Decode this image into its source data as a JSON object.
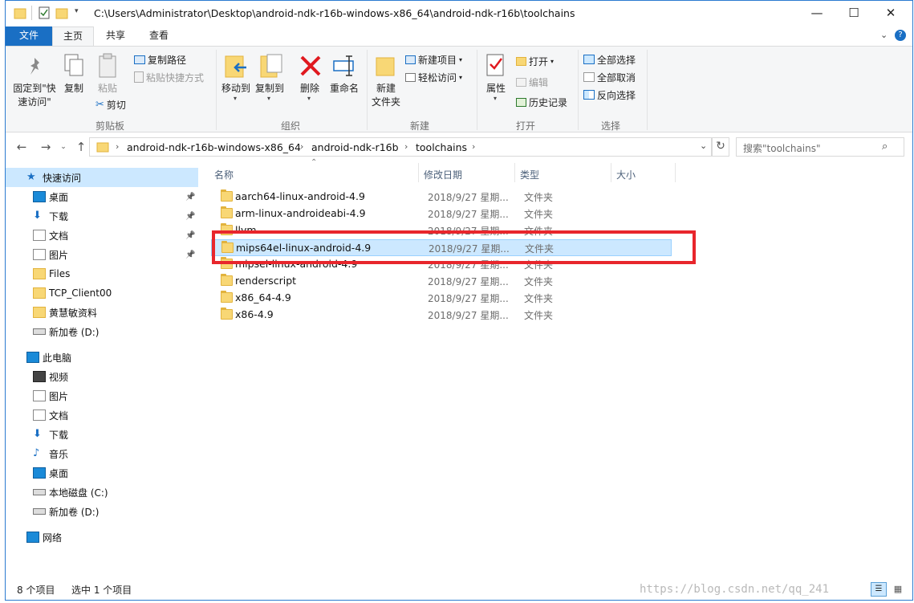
{
  "window": {
    "title": "C:\\Users\\Administrator\\Desktop\\android-ndk-r16b-windows-x86_64\\android-ndk-r16b\\toolchains",
    "minimize": "—",
    "maximize": "☐",
    "close": "✕"
  },
  "tabs": {
    "file": "文件",
    "home": "主页",
    "share": "共享",
    "view": "查看"
  },
  "ribbon": {
    "clipboard": {
      "pin_line1": "固定到\"快",
      "pin_line2": "速访问\"",
      "copy": "复制",
      "paste": "粘贴",
      "copy_path": "复制路径",
      "paste_shortcut": "粘贴快捷方式",
      "cut": "剪切",
      "group": "剪贴板"
    },
    "organize": {
      "move_to": "移动到",
      "copy_to": "复制到",
      "delete": "删除",
      "rename": "重命名",
      "group": "组织"
    },
    "new": {
      "new_folder_line1": "新建",
      "new_folder_line2": "文件夹",
      "new_item": "新建项目",
      "easy_access": "轻松访问",
      "group": "新建"
    },
    "open": {
      "properties": "属性",
      "open": "打开",
      "edit": "编辑",
      "history": "历史记录",
      "group": "打开"
    },
    "select": {
      "select_all": "全部选择",
      "select_none": "全部取消",
      "invert": "反向选择",
      "group": "选择"
    }
  },
  "address": {
    "crumbs": [
      "android-ndk-r16b-windows-x86_64",
      "android-ndk-r16b",
      "toolchains"
    ],
    "search_placeholder": "搜索\"toolchains\""
  },
  "nav": [
    {
      "label": "快速访问",
      "icon": "star-icon",
      "pinned": false
    },
    {
      "label": "桌面",
      "icon": "desktop-icon",
      "pinned": true
    },
    {
      "label": "下载",
      "icon": "download-icon",
      "pinned": true
    },
    {
      "label": "文档",
      "icon": "document-icon",
      "pinned": true
    },
    {
      "label": "图片",
      "icon": "picture-icon",
      "pinned": true
    },
    {
      "label": "Files",
      "icon": "folder-icon",
      "pinned": false
    },
    {
      "label": "TCP_Client00",
      "icon": "folder-icon",
      "pinned": false
    },
    {
      "label": "黄慧敏资料",
      "icon": "folder-icon",
      "pinned": false
    },
    {
      "label": "新加卷 (D:)",
      "icon": "drive-icon",
      "pinned": false
    },
    {
      "label": "此电脑",
      "icon": "computer-icon",
      "pinned": false
    },
    {
      "label": "视频",
      "icon": "video-icon",
      "pinned": false
    },
    {
      "label": "图片",
      "icon": "picture-icon",
      "pinned": false
    },
    {
      "label": "文档",
      "icon": "document-icon",
      "pinned": false
    },
    {
      "label": "下载",
      "icon": "download-icon",
      "pinned": false
    },
    {
      "label": "音乐",
      "icon": "music-icon",
      "pinned": false
    },
    {
      "label": "桌面",
      "icon": "desktop-icon",
      "pinned": false
    },
    {
      "label": "本地磁盘 (C:)",
      "icon": "drive-icon",
      "pinned": false
    },
    {
      "label": "新加卷 (D:)",
      "icon": "drive-icon",
      "pinned": false
    },
    {
      "label": "网络",
      "icon": "network-icon",
      "pinned": false
    }
  ],
  "columns": {
    "name": "名称",
    "date": "修改日期",
    "type": "类型",
    "size": "大小"
  },
  "files": [
    {
      "name": "aarch64-linux-android-4.9",
      "date": "2018/9/27 星期...",
      "type": "文件夹"
    },
    {
      "name": "arm-linux-androideabi-4.9",
      "date": "2018/9/27 星期...",
      "type": "文件夹"
    },
    {
      "name": "llvm",
      "date": "2018/9/27 星期...",
      "type": "文件夹"
    },
    {
      "name": "mips64el-linux-android-4.9",
      "date": "2018/9/27 星期...",
      "type": "文件夹",
      "selected": true
    },
    {
      "name": "mipsel-linux-android-4.9",
      "date": "2018/9/27 星期...",
      "type": "文件夹"
    },
    {
      "name": "renderscript",
      "date": "2018/9/27 星期...",
      "type": "文件夹"
    },
    {
      "name": "x86_64-4.9",
      "date": "2018/9/27 星期...",
      "type": "文件夹"
    },
    {
      "name": "x86-4.9",
      "date": "2018/9/27 星期...",
      "type": "文件夹"
    }
  ],
  "status": {
    "count": "8 个项目",
    "selected": "选中 1 个项目"
  },
  "watermark": "https://blog.csdn.net/qq_241",
  "colors": {
    "accent": "#1a6fc4",
    "selection": "#cce8ff",
    "highlight": "#e8262c",
    "folder": "#f8d775"
  }
}
